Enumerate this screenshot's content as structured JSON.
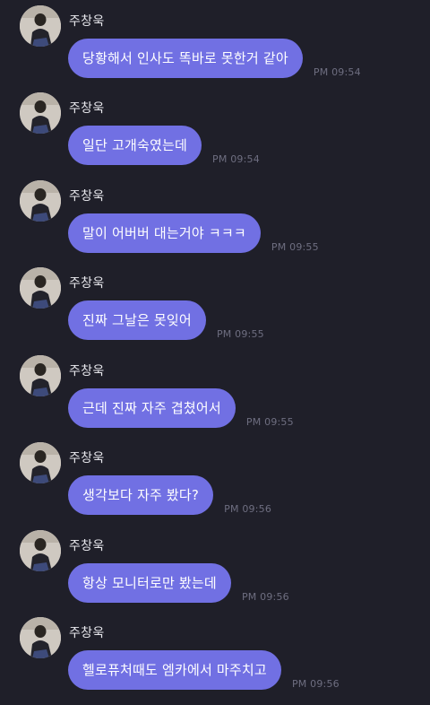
{
  "messages": [
    {
      "sender": "주창욱",
      "text": "당황해서 인사도 똑바로 못한거 같아",
      "time": "PM 09:54"
    },
    {
      "sender": "주창욱",
      "text": "일단 고개숙였는데",
      "time": "PM 09:54"
    },
    {
      "sender": "주창욱",
      "text": "말이 어버버 대는거야 ㅋㅋㅋ",
      "time": "PM 09:55"
    },
    {
      "sender": "주창욱",
      "text": "진짜 그날은 못잊어",
      "time": "PM 09:55"
    },
    {
      "sender": "주창욱",
      "text": "근데 진짜 자주 겹쳤어서",
      "time": "PM 09:55"
    },
    {
      "sender": "주창욱",
      "text": "생각보다 자주 봤다?",
      "time": "PM 09:56"
    },
    {
      "sender": "주창욱",
      "text": "항상 모니터로만 봤는데",
      "time": "PM 09:56"
    },
    {
      "sender": "주창욱",
      "text": "헬로퓨처때도 엠카에서 마주치고",
      "time": "PM 09:56"
    }
  ],
  "colors": {
    "background": "#1f1f29",
    "bubble": "#7170e3",
    "timestamp": "#6e6e80",
    "sender": "#e9e9ee"
  }
}
